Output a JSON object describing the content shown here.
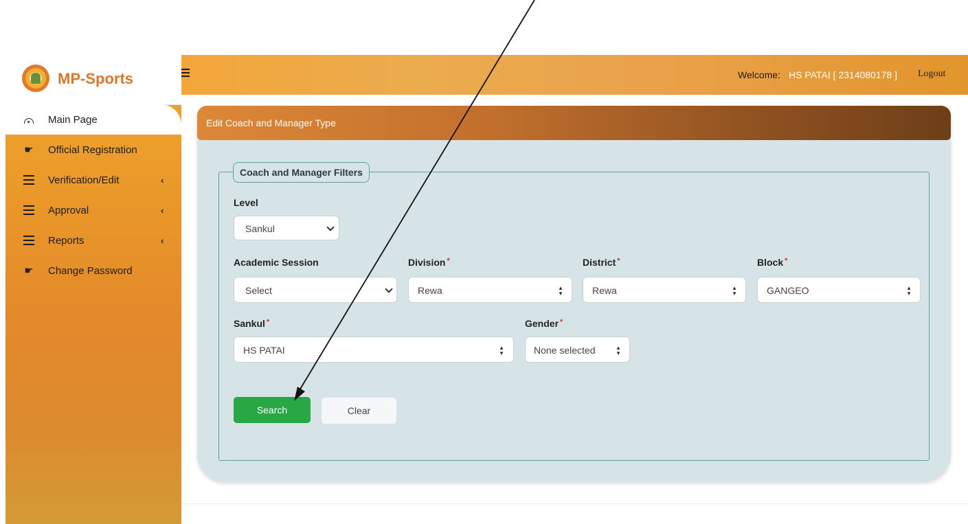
{
  "app": {
    "brand": "MP-Sports"
  },
  "header": {
    "welcome_prefix": "Welcome:",
    "welcome_user": "HS PATAI [ 2314080178 ]",
    "logout": "Logout"
  },
  "sidebar": {
    "items": [
      {
        "label": "Main Page",
        "icon": "gauge-icon",
        "active": true,
        "has_arrow": false
      },
      {
        "label": "Official Registration",
        "icon": "pointing-hand-icon",
        "has_arrow": false
      },
      {
        "label": "Verification/Edit",
        "icon": "list-icon",
        "has_arrow": true
      },
      {
        "label": "Approval",
        "icon": "list-icon",
        "has_arrow": true
      },
      {
        "label": "Reports",
        "icon": "list-icon",
        "has_arrow": true
      },
      {
        "label": "Change Password",
        "icon": "pointing-hand-icon",
        "has_arrow": false
      }
    ],
    "arrow_glyph": "‹"
  },
  "card": {
    "title": "Edit Coach and Manager Type",
    "fieldset_legend": "Coach and Manager Filters"
  },
  "form": {
    "required_mark": "*",
    "level": {
      "label": "Level",
      "value": "Sankul"
    },
    "academic_session": {
      "label": "Academic Session",
      "value": "Select"
    },
    "division": {
      "label": "Division",
      "value": "Rewa"
    },
    "district": {
      "label": "District",
      "value": "Rewa"
    },
    "block": {
      "label": "Block",
      "value": "GANGEO"
    },
    "sankul": {
      "label": "Sankul",
      "value": "HS PATAI"
    },
    "gender": {
      "label": "Gender",
      "value": "None selected"
    },
    "search_button": "Search",
    "clear_button": "Clear"
  },
  "colors": {
    "sidebar_orange": "#e48a2a",
    "brand_text": "#d8782a",
    "card_bg": "#d6e3e7",
    "fieldset_border": "#5aa7a0",
    "search_green": "#28a745",
    "required_red": "#e32b2b"
  }
}
